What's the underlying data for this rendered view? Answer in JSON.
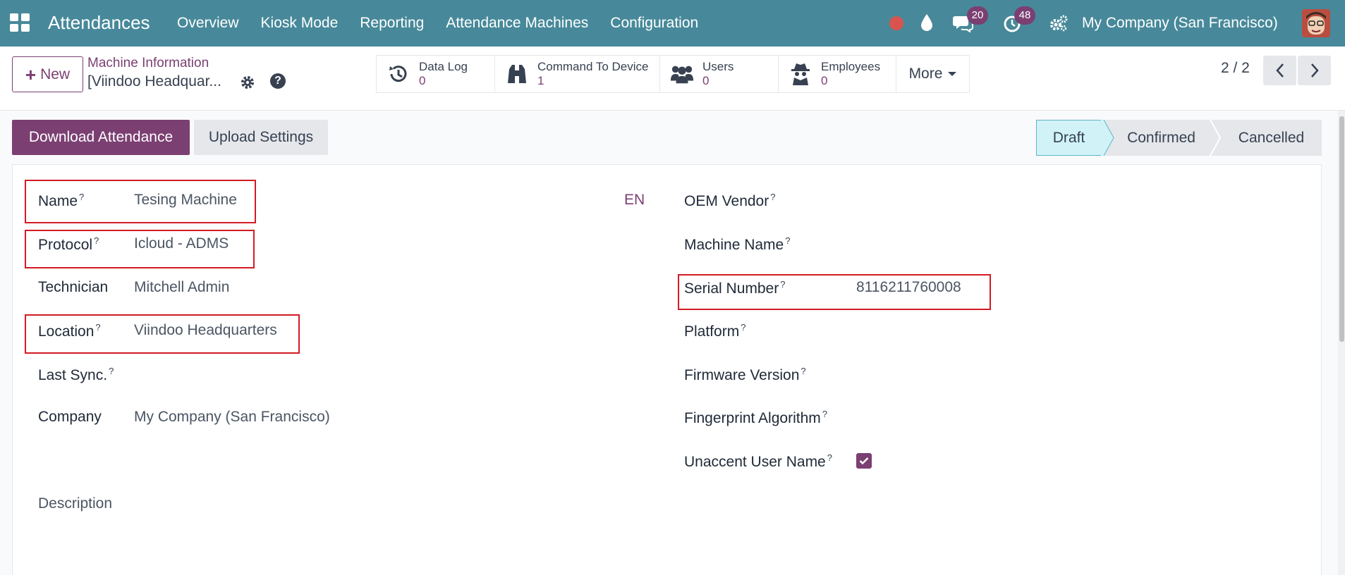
{
  "navbar": {
    "brand": "Attendances",
    "menu": [
      "Overview",
      "Kiosk Mode",
      "Reporting",
      "Attendance Machines",
      "Configuration"
    ],
    "messages_count": "20",
    "activities_count": "48",
    "company": "My Company (San Francisco)"
  },
  "control": {
    "new_label": "New",
    "breadcrumb_parent": "Machine Information",
    "breadcrumb_current": "[Viindoo Headquar...",
    "smart_buttons": [
      {
        "label": "Data Log",
        "value": "0",
        "icon": "history-icon"
      },
      {
        "label": "Command To Device",
        "value": "1",
        "icon": "binoculars-icon"
      },
      {
        "label": "Users",
        "value": "0",
        "icon": "users-icon"
      },
      {
        "label": "Employees",
        "value": "0",
        "icon": "spy-icon"
      }
    ],
    "more_label": "More",
    "pager": "2 / 2"
  },
  "statusbar": {
    "download_label": "Download Attendance",
    "upload_label": "Upload Settings",
    "stages": [
      "Draft",
      "Confirmed",
      "Cancelled"
    ],
    "active_stage": "Draft"
  },
  "form": {
    "left": [
      {
        "label": "Name",
        "help": "?",
        "value": "Tesing Machine"
      },
      {
        "label": "Protocol",
        "help": "?",
        "value": "Icloud - ADMS"
      },
      {
        "label": "Technician",
        "help": "",
        "value": "Mitchell Admin"
      },
      {
        "label": "Location",
        "help": "?",
        "value": "Viindoo Headquarters"
      },
      {
        "label": "Last Sync.",
        "help": "?",
        "value": ""
      },
      {
        "label": "Company",
        "help": "",
        "value": "My Company (San Francisco)"
      }
    ],
    "lang": "EN",
    "right": [
      {
        "label": "OEM Vendor",
        "help": "?",
        "value": ""
      },
      {
        "label": "Machine Name",
        "help": "?",
        "value": ""
      },
      {
        "label": "Serial Number",
        "help": "?",
        "value": "8116211760008"
      },
      {
        "label": "Platform",
        "help": "?",
        "value": ""
      },
      {
        "label": "Firmware Version",
        "help": "?",
        "value": ""
      },
      {
        "label": "Fingerprint Algorithm",
        "help": "?",
        "value": ""
      },
      {
        "label": "Unaccent User Name",
        "help": "?",
        "value": "",
        "checked": true
      }
    ],
    "description_label": "Description"
  },
  "colors": {
    "navbar": "#47899A",
    "primary": "#7b3f72",
    "highlight_box": "#d31b24",
    "draft_stage": "#d1f3f8"
  }
}
